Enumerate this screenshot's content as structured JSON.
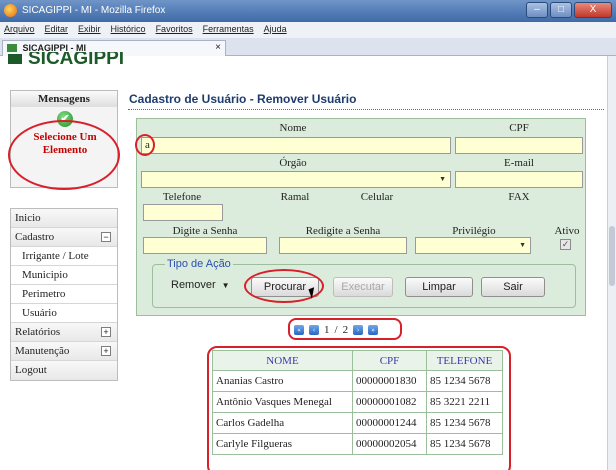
{
  "window": {
    "title": "SICAGIPPI - MI - Mozilla Firefox",
    "min": "–",
    "max": "□",
    "close": "X"
  },
  "menu": [
    "Arquivo",
    "Editar",
    "Exibir",
    "Histórico",
    "Favoritos",
    "Ferramentas",
    "Ajuda"
  ],
  "tab": {
    "label": "SICAGIPPI - MI",
    "close": "×"
  },
  "logo": "SICAGIPPI",
  "messages": {
    "header": "Mensagens",
    "text": "Selecione Um Elemento",
    "check": "✔"
  },
  "sidemenu": {
    "inicio": "Inicio",
    "cadastro": "Cadastro",
    "cadastro_toggle": "−",
    "cadastro_items": [
      "Irrigante / Lote",
      "Municipio",
      "Perimetro",
      "Usuário"
    ],
    "relatorios": "Relatórios",
    "relatorios_toggle": "+",
    "manutencao": "Manutenção",
    "manutencao_toggle": "+",
    "logout": "Logout"
  },
  "page_title": "Cadastro de Usuário - Remover Usuário",
  "form": {
    "nome_label": "Nome",
    "nome_value": "a",
    "cpf_label": "CPF",
    "cpf_value": "",
    "orgao_label": "Órgão",
    "orgao_value": "",
    "email_label": "E-mail",
    "email_value": "",
    "telefone_label": "Telefone",
    "ramal_label": "Ramal",
    "celular_label": "Celular",
    "fax_label": "FAX",
    "senha_label": "Digite a Senha",
    "resenha_label": "Redigite a Senha",
    "privilegio_label": "Privilégio",
    "ativo_label": "Ativo",
    "ativo_check": "✓"
  },
  "acao": {
    "legend": "Tipo de Ação",
    "select_value": "Remover",
    "procurar": "Procurar",
    "executar": "Executar",
    "limpar": "Limpar",
    "sair": "Sair"
  },
  "pager": {
    "page1": "1",
    "sep": "/",
    "page2": "2"
  },
  "table": {
    "headers": [
      "NOME",
      "CPF",
      "TELEFONE"
    ],
    "rows": [
      [
        "Ananias Castro",
        "00000001830",
        "85 1234 5678"
      ],
      [
        "Antônio Vasques Menegal",
        "00000001082",
        "85 3221 2211"
      ],
      [
        "Carlos Gadelha",
        "00000001244",
        "85 1234 5678"
      ],
      [
        "Carlyle Filgueras",
        "00000002054",
        "85 1234 5678"
      ]
    ]
  },
  "colors": {
    "accent_green": "#1d5a2a",
    "highlight_red": "#d8202a",
    "field_yellow": "#ffffd4",
    "panel_green": "#dcecdc"
  }
}
